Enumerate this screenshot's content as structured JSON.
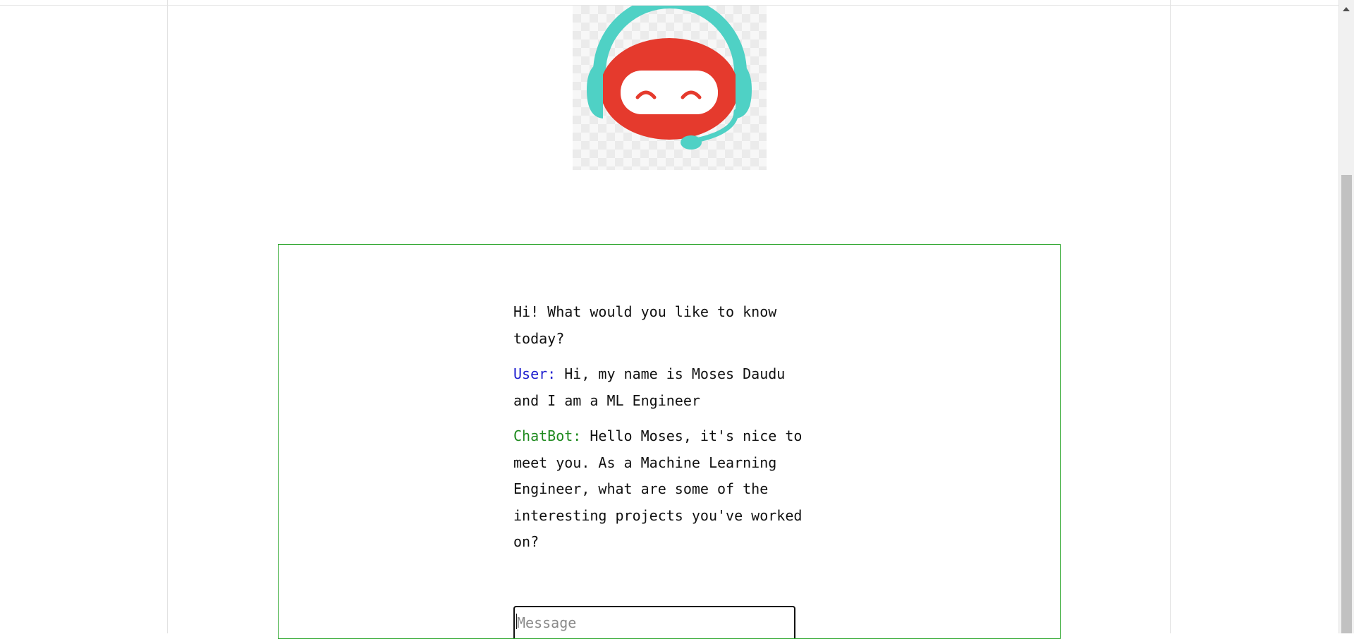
{
  "logo": {
    "icon": "robot-headset-icon",
    "colors": {
      "face": "#e53a2d",
      "headset": "#4fd1c5"
    }
  },
  "chat": {
    "greeting": "Hi! What would you like to know today?",
    "messages": [
      {
        "speaker": "User:",
        "text": "Hi, my name is Moses Daudu and I am a ML Engineer"
      },
      {
        "speaker": "ChatBot:",
        "text": "Hello Moses, it's nice to meet you. As a Machine Learning Engineer, what are some of the interesting projects you've worked on?"
      }
    ]
  },
  "input": {
    "placeholder": "Message",
    "value": ""
  },
  "colors": {
    "user_label": "#1c1ccf",
    "bot_label": "#1e8a1e",
    "chat_border": "#2aa52a"
  }
}
